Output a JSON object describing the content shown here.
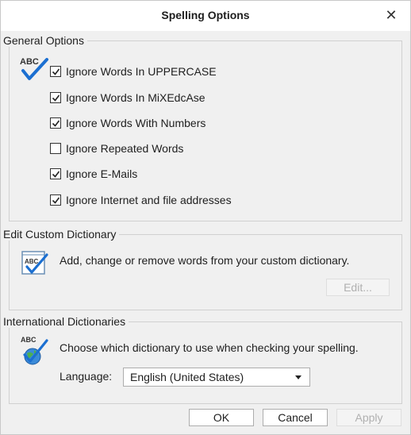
{
  "window": {
    "title": "Spelling Options"
  },
  "general": {
    "legend": "General Options",
    "options": [
      {
        "label": "Ignore Words In UPPERCASE",
        "checked": true
      },
      {
        "label": "Ignore Words In MiXEdcAse",
        "checked": true
      },
      {
        "label": "Ignore Words With Numbers",
        "checked": true
      },
      {
        "label": "Ignore Repeated Words",
        "checked": false
      },
      {
        "label": "Ignore E-Mails",
        "checked": true
      },
      {
        "label": "Ignore Internet and file addresses",
        "checked": true
      }
    ],
    "icon": "abc-checkmark-icon"
  },
  "custom_dictionary": {
    "legend": "Edit Custom Dictionary",
    "description": "Add, change or remove words from your custom dictionary.",
    "edit_label": "Edit...",
    "icon": "abc-notebook-icon"
  },
  "international": {
    "legend": "International Dictionaries",
    "description": "Choose which dictionary to use when checking your spelling.",
    "language_label": "Language:",
    "language_value": "English (United States)",
    "icon": "abc-globe-icon"
  },
  "buttons": {
    "ok": "OK",
    "cancel": "Cancel",
    "apply": "Apply"
  },
  "colors": {
    "check_blue": "#1b6fd1",
    "disabled_text": "#b0b0b0"
  }
}
